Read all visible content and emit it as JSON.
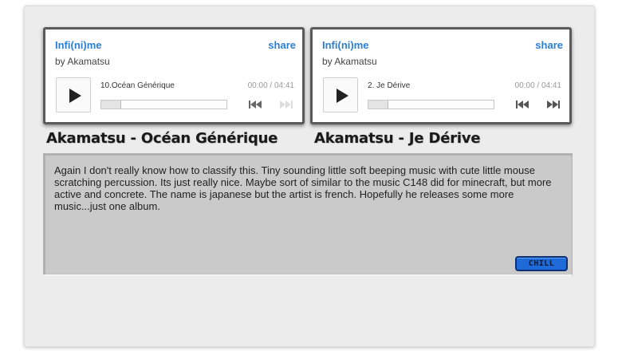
{
  "players": [
    {
      "album": "Infi(ni)me",
      "share_label": "share",
      "artist": "by Akamatsu",
      "track": "10.Océan Générique",
      "time": "00:00 / 04:41",
      "progress": 0.0
    },
    {
      "album": "Infi(ni)me",
      "share_label": "share",
      "artist": "by Akamatsu",
      "track": "2.  Je Dérive",
      "time": "00:00 / 04:41",
      "progress": 0.0
    }
  ],
  "captions": [
    "Akamatsu - Océan Générique",
    "Akamatsu - Je Dérive"
  ],
  "description": "Again I don't really know how to classify this. Tiny sounding little soft beeping music with cute little mouse scratching percussion. Its just really nice. Maybe sort of similar to the music C148 did for minecraft, but more active and concrete. The name is japanese but the artist is french. Hopefully he releases some more music...just one album.",
  "tag": "CHILL",
  "colors": {
    "link": "#2a7fd4",
    "tag": "#1e6ad8",
    "panel": "#cacaca"
  }
}
